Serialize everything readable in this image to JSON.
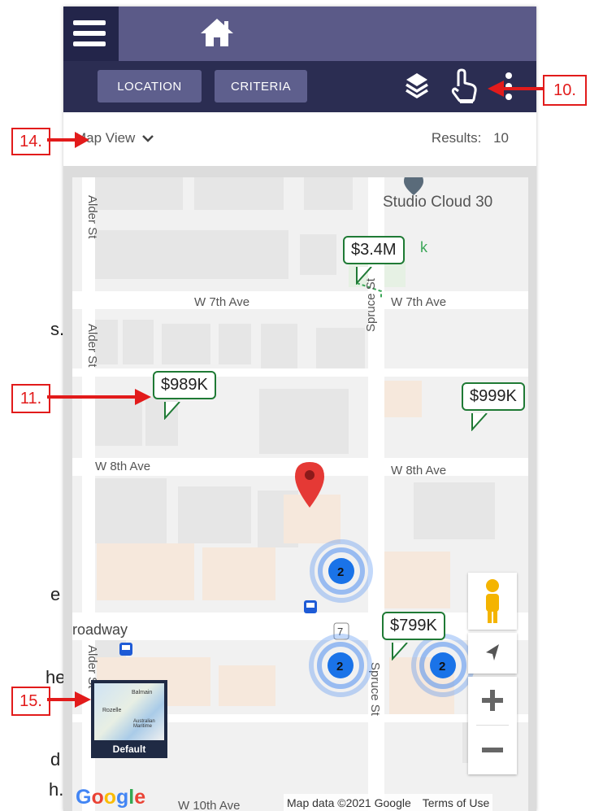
{
  "nav": {
    "menu_icon": "hamburger-menu-icon",
    "home_icon": "home-icon",
    "avatar_icon": "user-avatar-icon"
  },
  "toolbar": {
    "location_label": "LOCATION",
    "criteria_label": "CRITERIA",
    "layers_icon": "layers-icon",
    "pointer_icon": "hand-pointer-icon",
    "more_icon": "more-vertical-icon"
  },
  "viewbar": {
    "map_view_label": "Map View",
    "results_label": "Results:",
    "results_count": "10"
  },
  "map": {
    "streets": [
      "Alder St",
      "Alder St",
      "Alder St",
      "W 7th Ave",
      "W 7th Ave",
      "Spruce St",
      "Spruce St",
      "W 8th Ave",
      "W 8th Ave",
      "Broadway",
      "W 10th Ave"
    ],
    "poi": "Studio Cloud 30",
    "park_fragment": "k",
    "route_badge": "7",
    "prices": [
      "$3.4M",
      "$989K",
      "$999K",
      "$799K"
    ],
    "clusters": [
      "2",
      "2",
      "2"
    ],
    "map_type_label": "Default",
    "thumb_labels": [
      "Balmain",
      "Rozelle",
      "Australian Maritime"
    ],
    "attribution": "Map data ©2021 Google",
    "terms": "Terms of Use",
    "google_logo": "Google"
  },
  "annotations": {
    "a10": "10.",
    "a11": "11.",
    "a14": "14.",
    "a15": "15."
  },
  "background_text": {
    "t1": "s.",
    "t2": "e",
    "t3": "he",
    "t4": "d",
    "t5": "h."
  },
  "colors": {
    "topbar": "#2b2d52",
    "button": "#5e5f8d",
    "price_border": "#1f7a35",
    "annotation": "#e21b1b",
    "cluster": "#1a73e8"
  }
}
